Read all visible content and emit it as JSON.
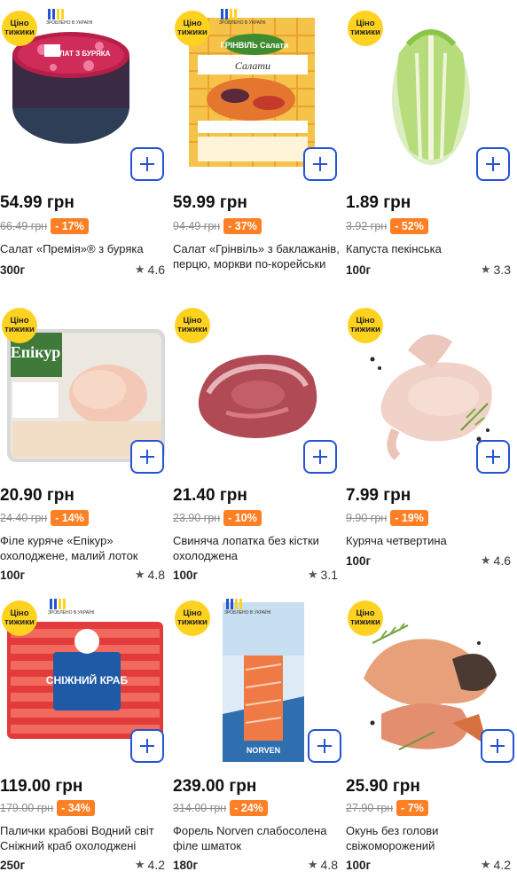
{
  "promo_label": "Ціно тижики",
  "promo_line1": "Ціно",
  "promo_line2": "тижики",
  "ua_badge_text": "ЗРОБЛЕНО В УКРАЇНІ",
  "add_icon": "plus-icon",
  "star_icon": "star-icon",
  "colors": {
    "accent": "#2453d4",
    "discount": "#ff7f24",
    "promo": "#ffd21f"
  },
  "products": [
    {
      "price": "54.99 грн",
      "old_price": "66.49 грн",
      "discount": "- 17%",
      "name": "Салат «Премія»® з буряка",
      "weight": "300г",
      "rating": "4.6",
      "image_text": "САЛАТ З БУРЯКА"
    },
    {
      "price": "59.99 грн",
      "old_price": "94.49 грн",
      "discount": "- 37%",
      "name": "Салат «Грінвіль» з баклажанів, перцю, моркви по-корейськи",
      "weight": "",
      "rating": "",
      "image_text": "ГРІНВІЛЬ Салати"
    },
    {
      "price": "1.89 грн",
      "old_price": "3.92 грн",
      "discount": "- 52%",
      "name": "Капуста пекінська",
      "weight": "100г",
      "rating": "3.3",
      "image_text": ""
    },
    {
      "price": "20.90 грн",
      "old_price": "24.40 грн",
      "discount": "- 14%",
      "name": "Філе куряче «Епікур» охолоджене, малий лоток",
      "weight": "100г",
      "rating": "4.8",
      "image_text": "Епікур"
    },
    {
      "price": "21.40 грн",
      "old_price": "23.90 грн",
      "discount": "- 10%",
      "name": "Свиняча лопатка без кістки охолоджена",
      "weight": "100г",
      "rating": "3.1",
      "image_text": ""
    },
    {
      "price": "7.99 грн",
      "old_price": "9.90 грн",
      "discount": "- 19%",
      "name": "Куряча четвертина",
      "weight": "100г",
      "rating": "4.6",
      "image_text": ""
    },
    {
      "price": "119.00 грн",
      "old_price": "179.00 грн",
      "discount": "- 34%",
      "name": "Палички крабові Водний світ Сніжний краб охолоджені",
      "weight": "250г",
      "rating": "4.2",
      "image_text": "СНІЖНИЙ КРАБ"
    },
    {
      "price": "239.00 грн",
      "old_price": "314.00 грн",
      "discount": "- 24%",
      "name": "Форель Norven слабосолена філе шматок",
      "weight": "180г",
      "rating": "4.8",
      "image_text": "NORVEN"
    },
    {
      "price": "25.90 грн",
      "old_price": "27.90 грн",
      "discount": "- 7%",
      "name": "Окунь без голови свіжоморожений",
      "weight": "100г",
      "rating": "4.2",
      "image_text": ""
    }
  ]
}
